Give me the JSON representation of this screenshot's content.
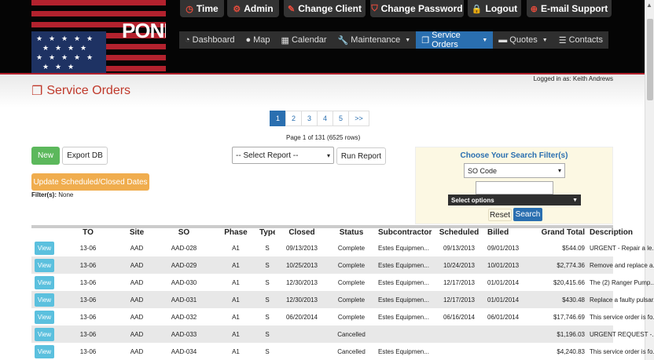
{
  "header": {
    "logo": "POND",
    "top_buttons": [
      {
        "label": "Time",
        "icon": "clock-icon"
      },
      {
        "label": "Admin",
        "icon": "gears-icon"
      },
      {
        "label": "Change Client",
        "icon": "edit-icon"
      },
      {
        "label": "Change Password",
        "icon": "shield-icon"
      },
      {
        "label": "Logout",
        "icon": "lock-icon"
      },
      {
        "label": "E-mail Support",
        "icon": "lifebuoy-icon"
      }
    ],
    "nav": [
      {
        "label": "Dashboard",
        "icon": "dashboard-icon"
      },
      {
        "label": "Map",
        "icon": "globe-icon"
      },
      {
        "label": "Calendar",
        "icon": "calendar-icon"
      },
      {
        "label": "Maintenance",
        "icon": "wrench-icon"
      },
      {
        "label": "Service Orders",
        "icon": "copy-icon"
      },
      {
        "label": "Quotes",
        "icon": "folder-icon"
      },
      {
        "label": "Contacts",
        "icon": "list-icon"
      }
    ],
    "logged_in": "Logged in as: Keith Andrews"
  },
  "page": {
    "title": "Service Orders",
    "pager": [
      "1",
      "2",
      "3",
      "4",
      "5",
      ">>"
    ],
    "page_info": "Page 1 of 131 (6525 rows)",
    "new_label": "New",
    "export_label": "Export DB",
    "update_label": "Update Scheduled/Closed Dates",
    "filters_label": "Filter(s):",
    "filters_value": " None",
    "report_select": "-- Select Report --",
    "run_report_label": "Run Report"
  },
  "search": {
    "title": "Choose Your Search Filter(s)",
    "field": "SO Code",
    "options_label": "Select options",
    "reset_label": "Reset",
    "search_label": "Search"
  },
  "table": {
    "columns": [
      "",
      "TO",
      "Site",
      "SO",
      "Phase",
      "Type",
      "Closed",
      "Status",
      "Subcontractor",
      "Scheduled",
      "Billed",
      "Grand Total",
      "Description"
    ],
    "view_label": "View",
    "rows": [
      [
        "13-06",
        "AAD",
        "AAD-028",
        "A1",
        "S",
        "09/13/2013",
        "Complete",
        "Estes Equipmen...",
        "09/13/2013",
        "09/01/2013",
        "$544.09",
        "URGENT - Repair a le..."
      ],
      [
        "13-06",
        "AAD",
        "AAD-029",
        "A1",
        "S",
        "10/25/2013",
        "Complete",
        "Estes Equipmen...",
        "10/24/2013",
        "10/01/2013",
        "$2,774.36",
        "Remove and replace a..."
      ],
      [
        "13-06",
        "AAD",
        "AAD-030",
        "A1",
        "S",
        "12/30/2013",
        "Complete",
        "Estes Equipmen...",
        "12/17/2013",
        "01/01/2014",
        "$20,415.66",
        "The (2) Ranger Pump..."
      ],
      [
        "13-06",
        "AAD",
        "AAD-031",
        "A1",
        "S",
        "12/30/2013",
        "Complete",
        "Estes Equipmen...",
        "12/17/2013",
        "01/01/2014",
        "$430.48",
        "Replace a faulty pulsar..."
      ],
      [
        "13-06",
        "AAD",
        "AAD-032",
        "A1",
        "S",
        "06/20/2014",
        "Complete",
        "Estes Equipmen...",
        "06/16/2014",
        "06/01/2014",
        "$17,746.69",
        "This service order is fo..."
      ],
      [
        "13-06",
        "AAD",
        "AAD-033",
        "A1",
        "S",
        "",
        "Cancelled",
        "",
        "",
        "",
        "$1,196.03",
        "URGENT REQUEST -..."
      ],
      [
        "13-06",
        "AAD",
        "AAD-034",
        "A1",
        "S",
        "",
        "Cancelled",
        "Estes Equipmen...",
        "",
        "",
        "$4,240.83",
        "This service order is fo..."
      ]
    ]
  },
  "colors": {
    "brand_red": "#c0392b",
    "primary_blue": "#2a6fb0",
    "success_green": "#5cb85c",
    "warning_orange": "#f0ad4e",
    "info_cyan": "#5bc0de"
  }
}
